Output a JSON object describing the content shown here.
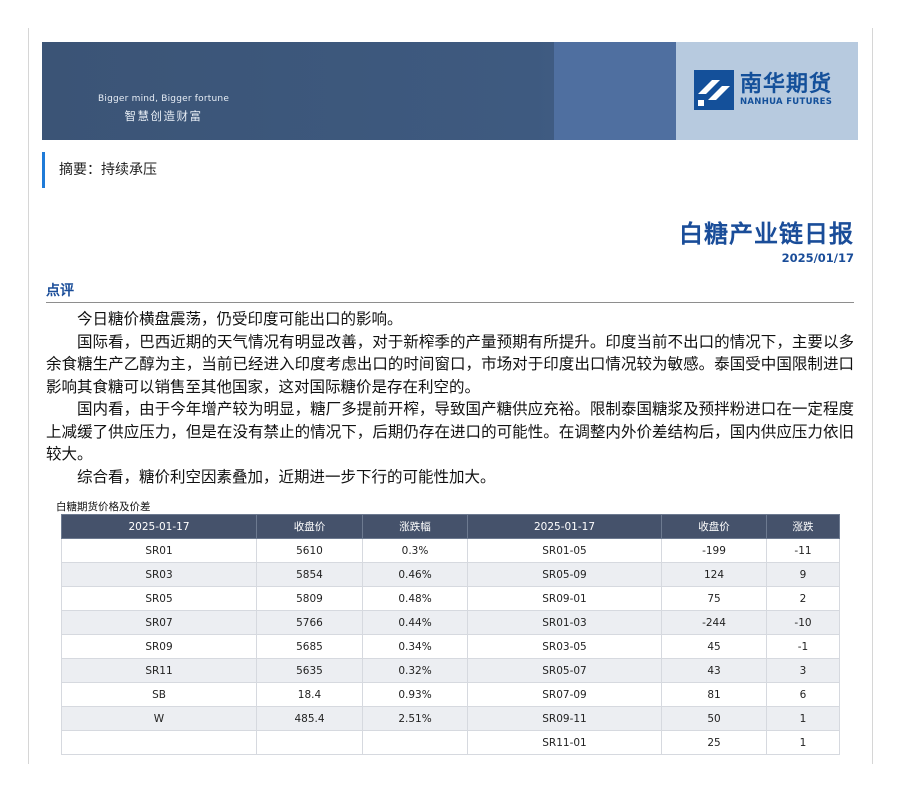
{
  "banner": {
    "slogan_en": "Bigger mind, Bigger fortune",
    "slogan_cn": "智慧创造财富",
    "brand_cn": "南华期货",
    "brand_en": "NANHUA FUTURES"
  },
  "summary": "摘要：持续承压",
  "report": {
    "title": "白糖产业链日报",
    "date": "2025/01/17"
  },
  "section": {
    "heading": "点评",
    "paragraphs": [
      "今日糖价横盘震荡，仍受印度可能出口的影响。",
      "国际看，巴西近期的天气情况有明显改善，对于新榨季的产量预期有所提升。印度当前不出口的情况下，主要以多余食糖生产乙醇为主，当前已经进入印度考虑出口的时间窗口，市场对于印度出口情况较为敏感。泰国受中国限制进口影响其食糖可以销售至其他国家，这对国际糖价是存在利空的。",
      "国内看，由于今年增产较为明显，糖厂多提前开榨，导致国产糖供应充裕。限制泰国糖浆及预拌粉进口在一定程度上减缓了供应压力，但是在没有禁止的情况下，后期仍存在进口的可能性。在调整内外价差结构后，国内供应压力依旧较大。",
      "综合看，糖价利空因素叠加，近期进一步下行的可能性加大。"
    ]
  },
  "table": {
    "caption": "白糖期货价格及价差",
    "headers": [
      "2025-01-17",
      "收盘价",
      "涨跌幅",
      "2025-01-17",
      "收盘价",
      "涨跌"
    ],
    "rows": [
      [
        "SR01",
        "5610",
        "0.3%",
        "SR01-05",
        "-199",
        "-11"
      ],
      [
        "SR03",
        "5854",
        "0.46%",
        "SR05-09",
        "124",
        "9"
      ],
      [
        "SR05",
        "5809",
        "0.48%",
        "SR09-01",
        "75",
        "2"
      ],
      [
        "SR07",
        "5766",
        "0.44%",
        "SR01-03",
        "-244",
        "-10"
      ],
      [
        "SR09",
        "5685",
        "0.34%",
        "SR03-05",
        "45",
        "-1"
      ],
      [
        "SR11",
        "5635",
        "0.32%",
        "SR05-07",
        "43",
        "3"
      ],
      [
        "SB",
        "18.4",
        "0.93%",
        "SR07-09",
        "81",
        "6"
      ],
      [
        "W",
        "485.4",
        "2.51%",
        "SR09-11",
        "50",
        "1"
      ],
      [
        "",
        "",
        "",
        "SR11-01",
        "25",
        "1"
      ]
    ]
  },
  "colors": {
    "banner_dark": "#3e5a80",
    "brand_blue": "#1a4d99",
    "summary_accent": "#1f7bd8",
    "table_header": "#45526b"
  }
}
